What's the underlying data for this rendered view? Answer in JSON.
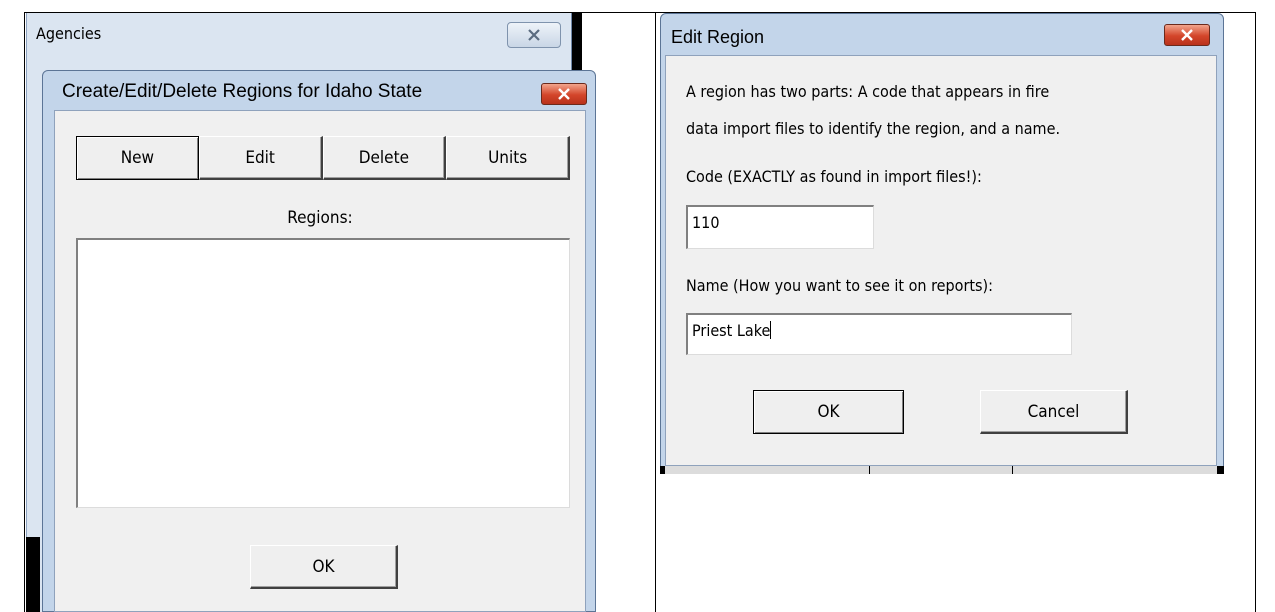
{
  "agencies_window": {
    "title": "Agencies"
  },
  "regions_dialog": {
    "title": "Create/Edit/Delete Regions for Idaho State",
    "buttons": {
      "new": "New",
      "edit": "Edit",
      "delete": "Delete",
      "units": "Units"
    },
    "regions_label": "Regions:",
    "regions_items": [],
    "ok_label": "OK"
  },
  "edit_region_dialog": {
    "title": "Edit Region",
    "description_line1": "A region has two parts: A code that appears in fire",
    "description_line2": "data import files to identify the region, and a name.",
    "code_label": "Code (EXACTLY as found in import files!):",
    "code_value": "110",
    "name_label": "Name (How you want to see it on reports):",
    "name_value": "Priest Lake",
    "ok_label": "OK",
    "cancel_label": "Cancel"
  },
  "icons": {
    "close": "close-x-icon"
  },
  "colors": {
    "title_bar": "#c3d5ea",
    "client": "#f0f0f0",
    "close_red": "#d3452a"
  }
}
